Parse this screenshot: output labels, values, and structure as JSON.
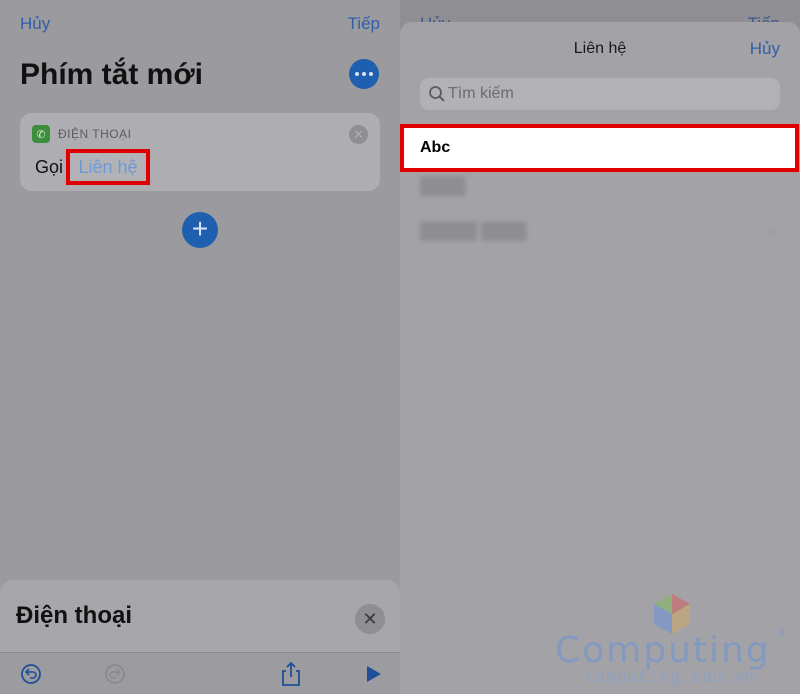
{
  "left_screen": {
    "nav": {
      "cancel_label": "Hủy",
      "next_label": "Tiếp"
    },
    "title": "Phím tắt mới",
    "action_card": {
      "app_name": "ĐIỆN THOẠI",
      "verb": "Gọi",
      "parameter": "Liên hệ"
    },
    "bottom_sheet": {
      "title": "Điện thoại"
    },
    "toolbar": [
      "undo-icon",
      "redo-icon",
      "share-icon",
      "play-icon"
    ]
  },
  "right_screen": {
    "underlay_nav": {
      "cancel_label": "Hủy",
      "next_label": "Tiếp"
    },
    "sheet": {
      "title": "Liên hệ",
      "cancel_label": "Hủy",
      "search_placeholder": "Tìm kiếm",
      "contacts": [
        "Abc"
      ]
    }
  },
  "watermark": {
    "name": "Computing",
    "url": "computing.edu.vn",
    "mark": "®"
  },
  "colors": {
    "accent": "#1f5fb0",
    "highlight": "#e00000"
  }
}
